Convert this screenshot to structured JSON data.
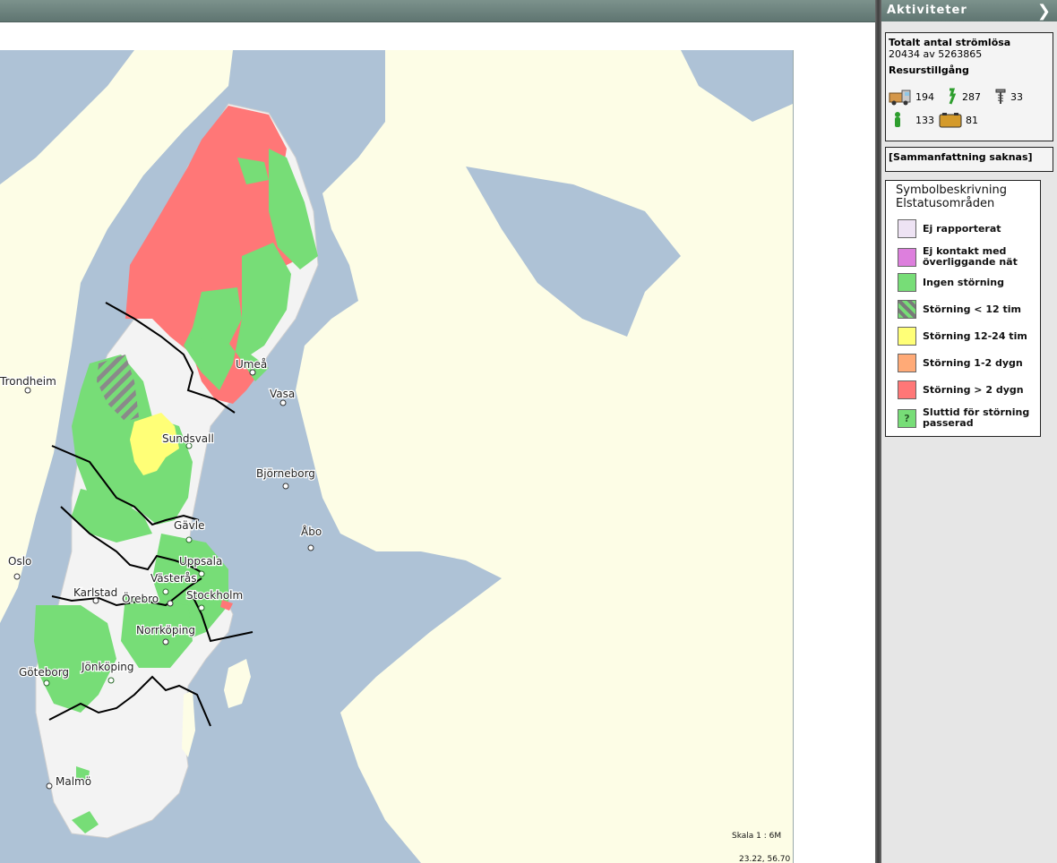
{
  "panel": {
    "title": "Aktiviteter"
  },
  "stats": {
    "total_label": "Totalt antal strömlösa",
    "total_value": "20434 av 5263865",
    "resources_label": "Resurstillgång",
    "resources": [
      {
        "icon": "truck-icon",
        "value": "194"
      },
      {
        "icon": "cable-green-icon",
        "value": "287"
      },
      {
        "icon": "screw-icon",
        "value": "33"
      },
      {
        "icon": "green-worker-icon",
        "value": "133"
      },
      {
        "icon": "generator-icon",
        "value": "81"
      }
    ]
  },
  "summary": "[Sammanfattning saknas]",
  "legend": {
    "title": "Symbolbeskrivning",
    "subtitle": "Elstatusområden",
    "items": [
      {
        "label": "Ej rapporterat",
        "color": "#eee3f4"
      },
      {
        "label": "Ej kontakt med överliggande nät",
        "color": "#dd7fdd"
      },
      {
        "label": "Ingen störning",
        "color": "#77dd77"
      },
      {
        "label": "Störning < 12 tim",
        "color": "hatch"
      },
      {
        "label": "Störning 12-24 tim",
        "color": "#ffff77"
      },
      {
        "label": "Störning 1-2 dygn",
        "color": "#ffaa77"
      },
      {
        "label": "Störning > 2 dygn",
        "color": "#ff7777"
      },
      {
        "label": "Sluttid för störning passerad",
        "color": "#77dd77",
        "mark": "?"
      }
    ]
  },
  "map": {
    "cities": [
      "Trondheim",
      "Umeå",
      "Vasa",
      "Sundsvall",
      "Björneborg",
      "Åbo",
      "Gävle",
      "Uppsala",
      "Oslo",
      "Västerås",
      "Karlstad",
      "Örebro",
      "Stockholm",
      "Norrköping",
      "Göteborg",
      "Jönköping",
      "Malmö"
    ],
    "scale": "Skala 1 : 6M",
    "coords": "23.22, 56.70"
  }
}
